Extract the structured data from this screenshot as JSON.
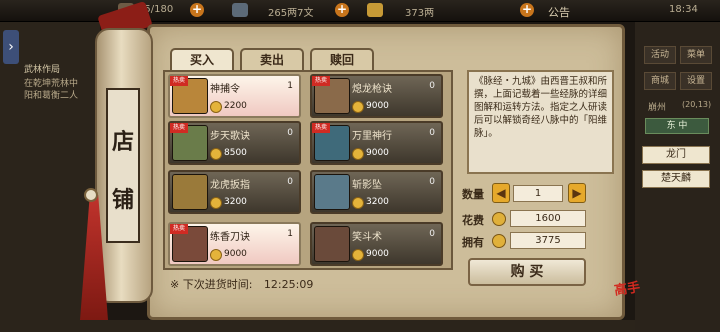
{
  "topbar": {
    "stamina": "25/180",
    "silver": "265两7文",
    "gold": "373两",
    "notice": "公告",
    "time": "18:34"
  },
  "left_panel": {
    "quest_title": "武林作局",
    "quest_line1": "在乾坤荒林中",
    "quest_line2": "阳和葛衡二人"
  },
  "right_panel": {
    "buttons": [
      "活动",
      "菜单",
      "商城",
      "设置"
    ],
    "location": "崩州",
    "coords": "(20,13)",
    "direction": "东 中",
    "sect": "龙门",
    "player": "楚天麟"
  },
  "shop": {
    "sign": [
      "店",
      "铺"
    ],
    "tabs": [
      "买入",
      "卖出",
      "赎回"
    ],
    "hot_label": "热卖",
    "items": [
      {
        "name": "神捕令",
        "count": "1",
        "price": "2200",
        "selected": true,
        "hot": true
      },
      {
        "name": "熄龙枪诀",
        "count": "0",
        "price": "9000",
        "selected": false,
        "hot": true
      },
      {
        "name": "步天歌诀",
        "count": "0",
        "price": "8500",
        "selected": false,
        "hot": true
      },
      {
        "name": "万里神行",
        "count": "0",
        "price": "9000",
        "selected": false,
        "hot": true
      },
      {
        "name": "龙虎扳指",
        "count": "0",
        "price": "3200",
        "selected": false,
        "hot": false
      },
      {
        "name": "斩影坠",
        "count": "0",
        "price": "3200",
        "selected": false,
        "hot": false
      },
      {
        "name": "练香刀诀",
        "count": "1",
        "price": "9000",
        "selected": true,
        "hot": true
      },
      {
        "name": "笑斗术",
        "count": "0",
        "price": "9000",
        "selected": false,
        "hot": false
      }
    ],
    "restock_label": "※ 下次进货时间:",
    "restock_time": "12:25:09",
    "description": "《脉经・九城》由西晋王叔和所撰，上面记载着一些经脉的详细图解和运转方法。指定之人研读后可以解锁奇经八脉中的「阳维脉」。",
    "quantity_label": "数量",
    "quantity": "1",
    "cost_label": "花费",
    "cost": "1600",
    "own_label": "拥有",
    "own": "3775",
    "buy_label": "购 买",
    "logo": "高手"
  },
  "colors": {
    "parchment": "#cdbd9a",
    "accent": "#c8751c",
    "ribbon": "#8c1e17"
  }
}
